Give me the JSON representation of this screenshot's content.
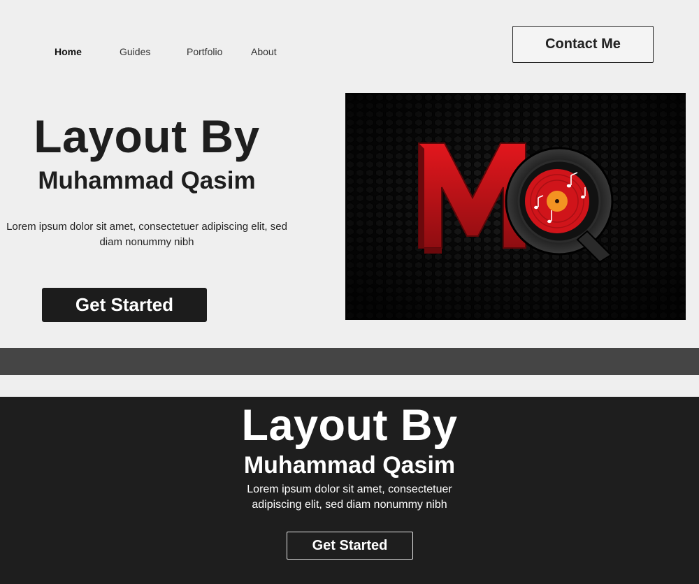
{
  "nav": {
    "items": [
      {
        "label": "Home",
        "active": true
      },
      {
        "label": "Guides",
        "active": false
      },
      {
        "label": "Portfolio",
        "active": false
      },
      {
        "label": "About",
        "active": false
      }
    ],
    "contact_label": "Contact Me"
  },
  "hero": {
    "title": "Layout By",
    "subtitle": "Muhammad Qasim",
    "description": "Lorem ipsum dolor sit amet, consectetuer adipiscing elit, sed diam nonummy nibh",
    "cta_label": "Get Started",
    "image": {
      "subject": "MQ logo on hexagon mesh background",
      "brand_colors": {
        "red": "#d0141a",
        "orange": "#f39322",
        "background": "#0a0a0a"
      }
    }
  },
  "dark_section": {
    "title": "Layout By",
    "subtitle": "Muhammad Qasim",
    "description": "Lorem ipsum dolor sit amet, consectetuer adipiscing elit, sed diam nonummy nibh",
    "cta_label": "Get Started"
  },
  "colors": {
    "page_background": "#efefef",
    "dark_section": "#1e1e1e",
    "divider": "#454545",
    "text_dark": "#1e1e1e"
  }
}
